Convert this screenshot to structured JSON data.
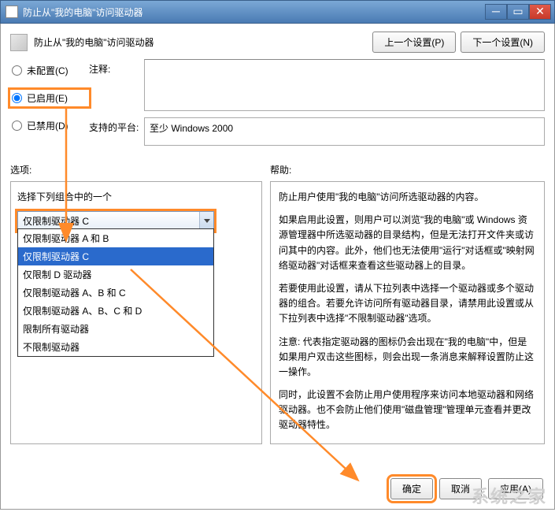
{
  "window": {
    "title": "防止从\"我的电脑\"访问驱动器"
  },
  "header": {
    "title": "防止从\"我的电脑\"访问驱动器",
    "prev_btn": "上一个设置(P)",
    "next_btn": "下一个设置(N)"
  },
  "radios": {
    "not_configured": "未配置(C)",
    "enabled": "已启用(E)",
    "disabled": "已禁用(D)"
  },
  "fields": {
    "comment_label": "注释:",
    "comment_value": "",
    "platform_label": "支持的平台:",
    "platform_value": "至少 Windows 2000"
  },
  "sections": {
    "options_label": "选项:",
    "help_label": "帮助:"
  },
  "options": {
    "dropdown_label": "选择下列组合中的一个",
    "selected": "仅限制驱动器 C",
    "items": [
      "仅限制驱动器 A 和 B",
      "仅限制驱动器 C",
      "仅限制 D 驱动器",
      "仅限制驱动器 A、B 和 C",
      "仅限制驱动器 A、B、C 和 D",
      "限制所有驱动器",
      "不限制驱动器"
    ]
  },
  "help": {
    "p1": "防止用户使用\"我的电脑\"访问所选驱动器的内容。",
    "p2": "如果启用此设置，则用户可以浏览\"我的电脑\"或 Windows 资源管理器中所选驱动器的目录结构，但是无法打开文件夹或访问其中的内容。此外，他们也无法使用\"运行\"对话框或\"映射网络驱动器\"对话框来查看这些驱动器上的目录。",
    "p3": "若要使用此设置，请从下拉列表中选择一个驱动器或多个驱动器的组合。若要允许访问所有驱动器目录，请禁用此设置或从下拉列表中选择\"不限制驱动器\"选项。",
    "p4": "注意: 代表指定驱动器的图标仍会出现在\"我的电脑\"中，但是如果用户双击这些图标，则会出现一条消息来解释设置防止这一操作。",
    "p5": "同时，此设置不会防止用户使用程序来访问本地驱动器和网络驱动器。也不会防止他们使用\"磁盘管理\"管理单元查看并更改驱动器特性。"
  },
  "footer": {
    "ok": "确定",
    "cancel": "取消",
    "apply": "应用(A)"
  },
  "annotation": {
    "highlight_color": "#ff8a2a"
  }
}
